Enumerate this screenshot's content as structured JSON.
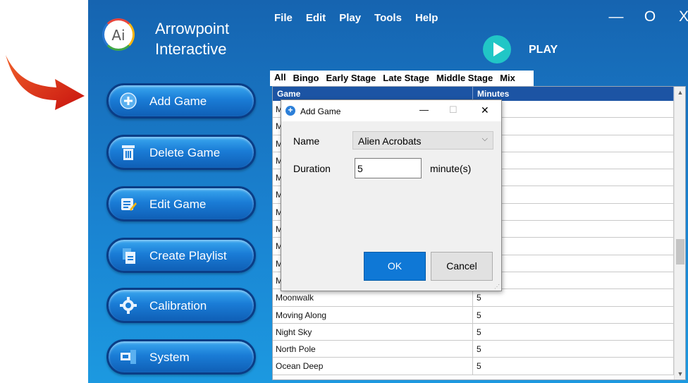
{
  "brand": {
    "logo_text": "Ai",
    "line1": "Arrowpoint",
    "line2": "Interactive"
  },
  "menu": [
    "File",
    "Edit",
    "Play",
    "Tools",
    "Help"
  ],
  "window_controls": {
    "minimize": "—",
    "maximize": "O",
    "close": "X"
  },
  "play": {
    "label": "PLAY"
  },
  "nav": [
    {
      "label": "Add Game",
      "icon": "plus-circle-icon"
    },
    {
      "label": "Delete Game",
      "icon": "trash-icon"
    },
    {
      "label": "Edit Game",
      "icon": "edit-list-icon"
    },
    {
      "label": "Create Playlist",
      "icon": "playlist-icon"
    },
    {
      "label": "Calibration",
      "icon": "calibration-gear-icon"
    },
    {
      "label": "System",
      "icon": "system-icon"
    }
  ],
  "tabs": [
    "All",
    "Bingo",
    "Early Stage",
    "Late Stage",
    "Middle Stage",
    "Mix"
  ],
  "table": {
    "headers": [
      "Game",
      "Minutes"
    ],
    "rows": [
      {
        "game": "M",
        "minutes": ""
      },
      {
        "game": "M",
        "minutes": ""
      },
      {
        "game": "M",
        "minutes": ""
      },
      {
        "game": "M",
        "minutes": ""
      },
      {
        "game": "M",
        "minutes": ""
      },
      {
        "game": "M",
        "minutes": ""
      },
      {
        "game": "M",
        "minutes": ""
      },
      {
        "game": "M",
        "minutes": ""
      },
      {
        "game": "M",
        "minutes": ""
      },
      {
        "game": "M",
        "minutes": ""
      },
      {
        "game": "M",
        "minutes": ""
      },
      {
        "game": "Moonwalk",
        "minutes": "5"
      },
      {
        "game": "Moving Along",
        "minutes": "5"
      },
      {
        "game": "Night Sky",
        "minutes": "5"
      },
      {
        "game": "North Pole",
        "minutes": "5"
      },
      {
        "game": "Ocean Deep",
        "minutes": "5"
      }
    ]
  },
  "dialog": {
    "title": "Add Game",
    "icon_glyph": "+",
    "min_glyph": "—",
    "max_glyph": "☐",
    "close_glyph": "✕",
    "name_label": "Name",
    "name_value": "Alien Acrobats",
    "duration_label": "Duration",
    "duration_value": "5",
    "duration_unit": "minute(s)",
    "ok_label": "OK",
    "cancel_label": "Cancel"
  },
  "colors": {
    "app_blue": "#1a84d2",
    "table_header": "#1c54a4",
    "play_teal": "#21c6c6",
    "ok_blue": "#0f78d6",
    "pointer_red": "#e0231b"
  }
}
